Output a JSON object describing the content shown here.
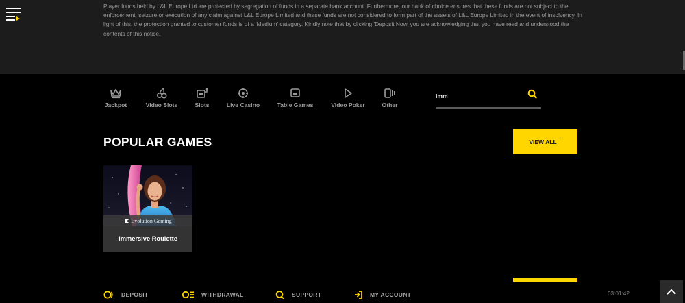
{
  "notice": {
    "text": "Player funds held by L&L Europe Ltd are protected by segregation of funds in a separate bank account. Furthermore, our bank of choice ensures that these funds are not subject to the enforcement, seizure or execution of any claim against L&L Europe Limited and these funds are not considered to form part of the assets of L&L Europe Limited in the event of insolvency. In light of this, the protection granted to customer funds is of a 'Medium' category. Kindly note that by clicking 'Deposit Now' you are acknowledging that you have read and understood the contents of this notice."
  },
  "categories": [
    {
      "label": "Jackpot",
      "icon": "crown-icon"
    },
    {
      "label": "Video Slots",
      "icon": "cherries-icon"
    },
    {
      "label": "Slots",
      "icon": "slot-machine-icon"
    },
    {
      "label": "Live Casino",
      "icon": "roulette-wheel-icon"
    },
    {
      "label": "Table Games",
      "icon": "card-table-icon"
    },
    {
      "label": "Video Poker",
      "icon": "play-icon"
    },
    {
      "label": "Other",
      "icon": "other-games-icon"
    }
  ],
  "search": {
    "value": "imm",
    "placeholder": ""
  },
  "section": {
    "title": "POPULAR GAMES",
    "view_all": "VIEW ALL",
    "view_all_chevron": "ˇ"
  },
  "games": [
    {
      "title": "Immersive Roulette",
      "provider": "Evolution Gaming"
    }
  ],
  "bottom_nav": [
    {
      "label": "DEPOSIT",
      "icon": "deposit-icon"
    },
    {
      "label": "WITHDRAWAL",
      "icon": "withdrawal-icon"
    },
    {
      "label": "SUPPORT",
      "icon": "support-icon"
    },
    {
      "label": "MY ACCOUNT",
      "icon": "login-icon"
    }
  ],
  "clock": "03:01:42",
  "colors": {
    "accent": "#ffd600",
    "background": "#000000",
    "panel": "#1c1c1c",
    "muted_text": "#9b9b9b"
  }
}
